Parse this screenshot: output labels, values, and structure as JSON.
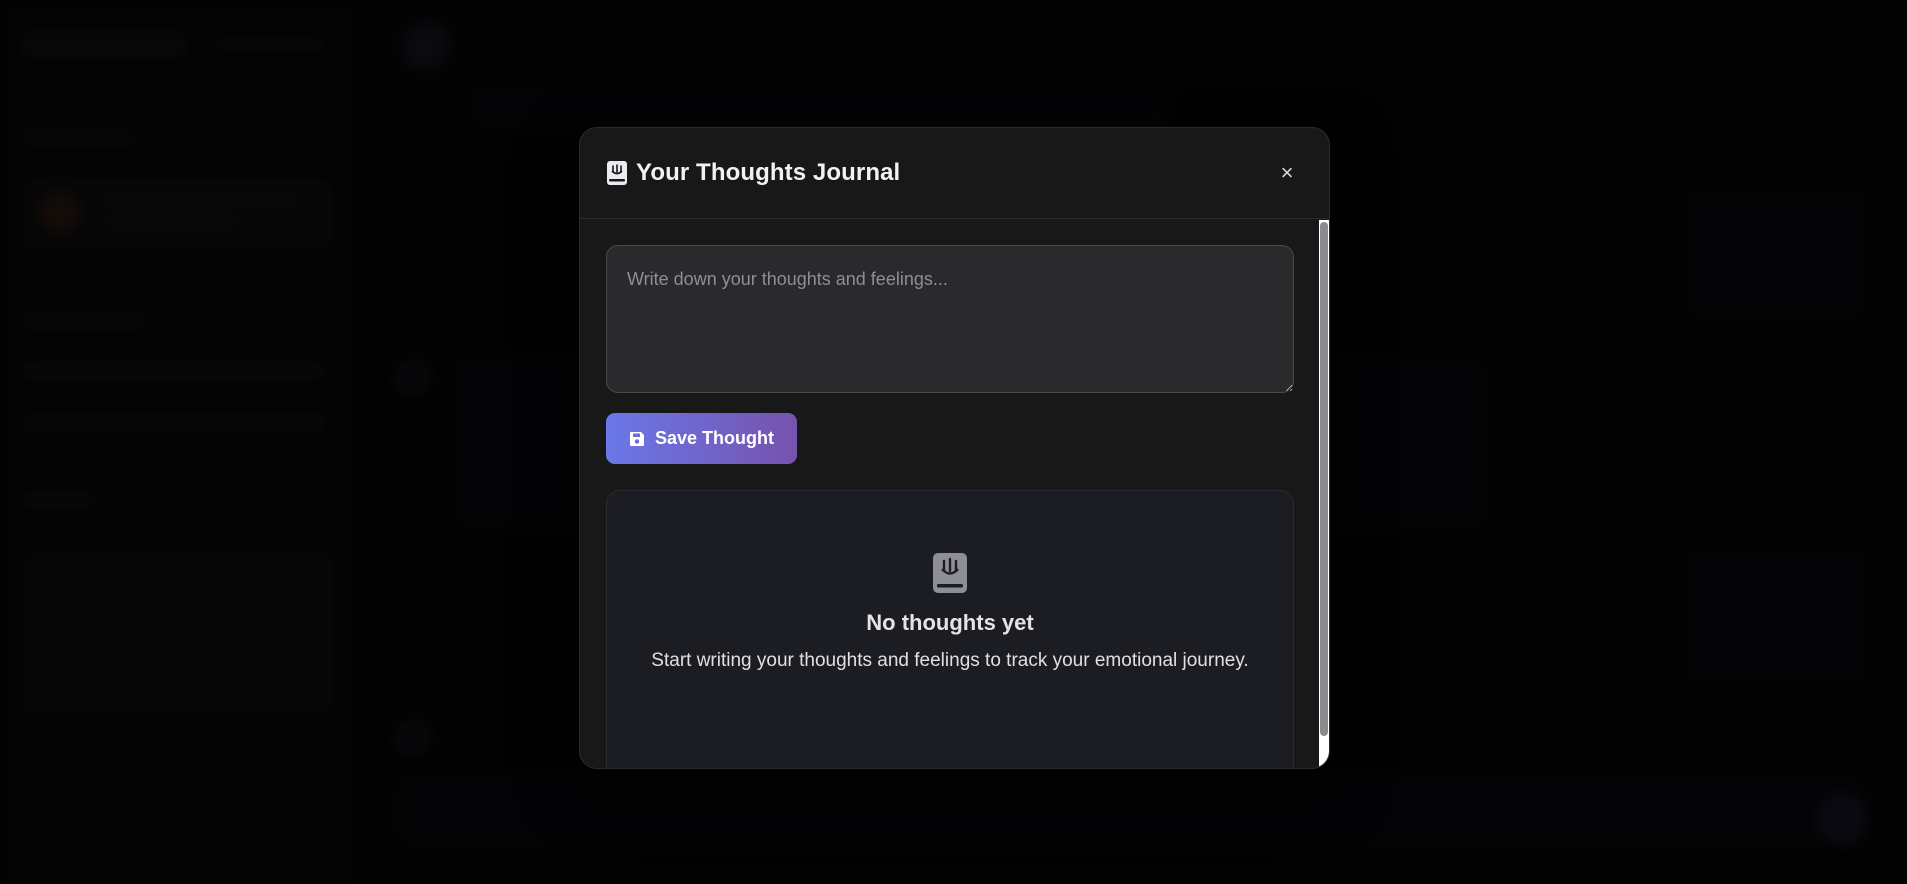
{
  "modal": {
    "title": "Your Thoughts Journal",
    "title_icon": "journal-icon",
    "close_label": "×",
    "input": {
      "placeholder": "Write down your thoughts and feelings...",
      "value": ""
    },
    "save_button": {
      "label": "Save Thought",
      "icon": "floppy-disk-icon"
    },
    "empty_state": {
      "icon": "journal-icon",
      "title": "No thoughts yet",
      "text": "Start writing your thoughts and feelings to track your emotional journey."
    }
  },
  "colors": {
    "accent_gradient_start": "#6a78e8",
    "accent_gradient_end": "#7752ae",
    "modal_background": "#181819",
    "page_background": "#050506"
  }
}
